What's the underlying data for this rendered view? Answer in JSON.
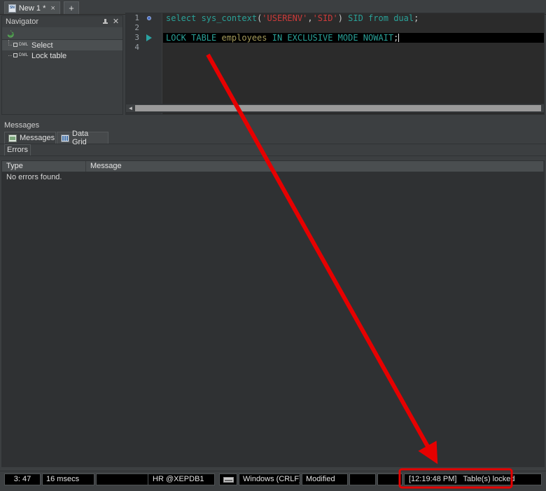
{
  "tabbar": {
    "tabs": [
      {
        "label": "New 1 *",
        "icon": "sql-file-icon",
        "close": "×"
      }
    ],
    "add_label": "+"
  },
  "navigator": {
    "title": "Navigator",
    "pin_icon": "pin-icon",
    "close_icon": "close-icon",
    "refresh_icon": "refresh-icon",
    "items": [
      {
        "label": "Select",
        "kind": "DML"
      },
      {
        "label": "Lock table",
        "kind": "DML"
      }
    ]
  },
  "editor": {
    "lines": [
      {
        "number": "1",
        "marker": "breakpoint-dot",
        "highlight": false
      },
      {
        "number": "2",
        "marker": "",
        "highlight": false
      },
      {
        "number": "3",
        "marker": "run-statement-arrow",
        "highlight": true
      },
      {
        "number": "4",
        "marker": "",
        "highlight": false
      }
    ],
    "code": {
      "line1": {
        "t1": "select ",
        "t2": "sys_context",
        "t3": "(",
        "t4": "'USERENV'",
        "t5": ",",
        "t6": "'SID'",
        "t7": ") ",
        "t8": "SID",
        "t9": " from ",
        "t10": "dual",
        "t11": ";"
      },
      "line3": {
        "t1": "LOCK TABLE ",
        "t2": "employees",
        "t3": " IN EXCLUSIVE MODE NOWAIT",
        "t4": ";"
      }
    },
    "scroll_left_arrow": "◄"
  },
  "messages": {
    "panel_title": "Messages",
    "tabs": [
      {
        "label": "Messages",
        "icon": "messages-icon",
        "active": true
      },
      {
        "label": "Data Grid",
        "icon": "grid-icon",
        "active": false
      }
    ],
    "subtabs": [
      {
        "label": "Errors",
        "active": true
      }
    ],
    "table": {
      "columns": [
        "Type",
        "Message"
      ],
      "empty_text": "No errors found."
    }
  },
  "statusbar": {
    "position": "3:  47",
    "elapsed": "16 msecs",
    "blank1": "",
    "connection": "HR @XEPDB1",
    "insert_icon": "keyboard-icon",
    "line_ending": "Windows (CRLF)",
    "modified": "Modified",
    "blank2": "",
    "blank3": "",
    "status_time": "[12:19:48 PM]",
    "status_text": "Table(s) locked"
  },
  "annotations": {
    "arrow_color": "#e60000",
    "highlight_box_color": "#e60000"
  }
}
